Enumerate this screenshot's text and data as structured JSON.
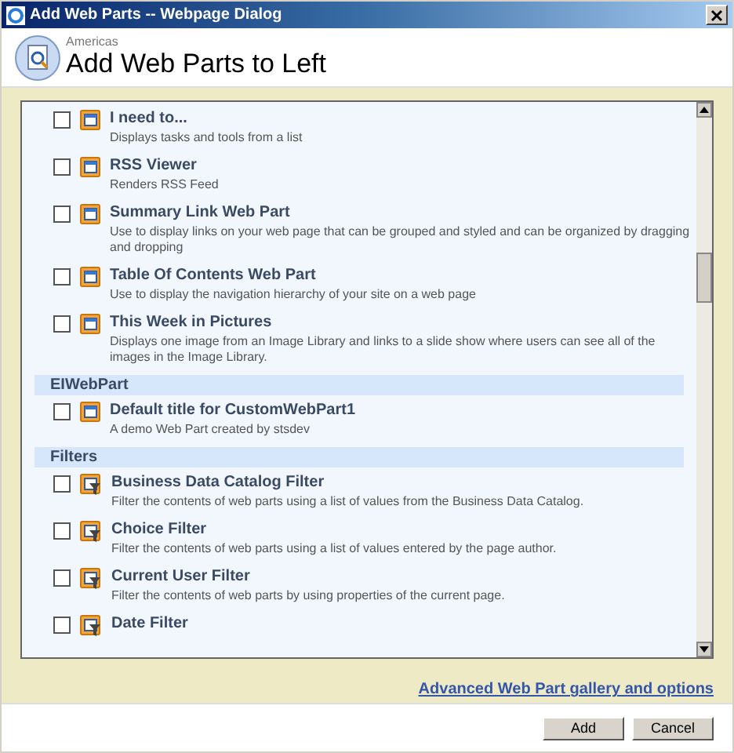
{
  "window": {
    "title": "Add Web Parts -- Webpage Dialog"
  },
  "header": {
    "site": "Americas",
    "title": "Add Web Parts to Left"
  },
  "groups": [
    {
      "items": [
        {
          "title": "I need to...",
          "description": "Displays tasks and tools from a list",
          "kind": "webpart",
          "checked": false
        },
        {
          "title": "RSS Viewer",
          "description": "Renders RSS Feed",
          "kind": "webpart",
          "checked": false
        },
        {
          "title": "Summary Link Web Part",
          "description": "Use to display links on your web page that can be grouped and styled and can be organized by dragging and dropping",
          "kind": "webpart",
          "checked": false
        },
        {
          "title": "Table Of Contents Web Part",
          "description": "Use to display the navigation hierarchy of your site on a web page",
          "kind": "webpart",
          "checked": false
        },
        {
          "title": "This Week in Pictures",
          "description": "Displays one image from an Image Library and links to a slide show where users can see all of the images in the Image Library.",
          "kind": "webpart",
          "checked": false
        }
      ]
    },
    {
      "heading": "EIWebPart",
      "items": [
        {
          "title": "Default title for CustomWebPart1",
          "description": "A demo Web Part created by stsdev",
          "kind": "webpart",
          "checked": false
        }
      ]
    },
    {
      "heading": "Filters",
      "items": [
        {
          "title": "Business Data Catalog Filter",
          "description": "Filter the contents of web parts using a list of values from the Business Data Catalog.",
          "kind": "filter",
          "checked": false
        },
        {
          "title": "Choice Filter",
          "description": "Filter the contents of web parts using a list of values entered by the page author.",
          "kind": "filter",
          "checked": false
        },
        {
          "title": "Current User Filter",
          "description": "Filter the contents of web parts by using properties of the current page.",
          "kind": "filter",
          "checked": false
        },
        {
          "title": "Date Filter",
          "kind": "filter",
          "checked": false
        }
      ]
    }
  ],
  "link": "Advanced Web Part gallery and options",
  "buttons": [
    "Add",
    "Cancel"
  ]
}
